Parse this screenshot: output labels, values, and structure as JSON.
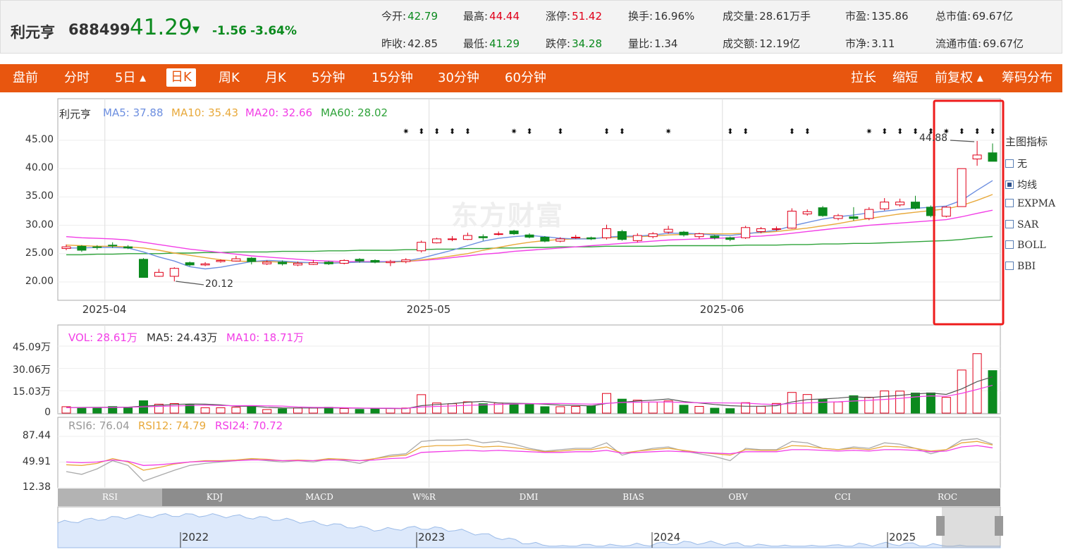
{
  "quote": {
    "name": "利元亨",
    "code": "688499",
    "price": "41.29",
    "arrow": "▼",
    "change": "-1.56",
    "change_pct": "-3.64%",
    "stats": [
      {
        "label": "今开:",
        "value": "42.79",
        "color": "green"
      },
      {
        "label": "最高:",
        "value": "44.44",
        "color": "red"
      },
      {
        "label": "涨停:",
        "value": "51.42",
        "color": "red"
      },
      {
        "label": "换手:",
        "value": "16.96%",
        "color": ""
      },
      {
        "label": "成交量:",
        "value": "28.61万手",
        "color": ""
      },
      {
        "label": "市盈:",
        "value": "135.86",
        "color": ""
      },
      {
        "label": "总市值:",
        "value": "69.67亿",
        "color": ""
      },
      {
        "label": "昨收:",
        "value": "42.85",
        "color": ""
      },
      {
        "label": "最低:",
        "value": "41.29",
        "color": "green"
      },
      {
        "label": "跌停:",
        "value": "34.28",
        "color": "green"
      },
      {
        "label": "量比:",
        "value": "1.34",
        "color": ""
      },
      {
        "label": "成交额:",
        "value": "12.19亿",
        "color": ""
      },
      {
        "label": "市净:",
        "value": "3.11",
        "color": ""
      },
      {
        "label": "流通市值:",
        "value": "69.67亿",
        "color": ""
      }
    ]
  },
  "toolbar": {
    "left": [
      "盘前",
      "分时",
      "5日 ▴",
      "日K",
      "周K",
      "月K",
      "5分钟",
      "15分钟",
      "30分钟",
      "60分钟"
    ],
    "active": "日K",
    "right": [
      "拉长",
      "缩短",
      "前复权 ▴",
      "筹码分布"
    ]
  },
  "main_legend": {
    "name": "利元亨",
    "ma5": "MA5: 37.88",
    "ma10": "MA10: 35.43",
    "ma20": "MA20: 32.66",
    "ma60": "MA60: 28.02"
  },
  "vol_legend": {
    "vol": "VOL: 28.61万",
    "ma5": "MA5: 24.43万",
    "ma10": "MA10: 18.71万"
  },
  "rsi_legend": {
    "rsi6": "RSI6: 76.04",
    "rsi12": "RSI12: 74.79",
    "rsi24": "RSI24: 70.72"
  },
  "annotations": {
    "high": "44.88",
    "low": "20.12"
  },
  "watermark": "东方财富",
  "side_panel": {
    "title": "主图指标",
    "options": [
      "无",
      "均线",
      "EXPMA",
      "SAR",
      "BOLL",
      "BBI"
    ],
    "checked": "均线"
  },
  "indicator_tabs": [
    "RSI",
    "KDJ",
    "MACD",
    "W%R",
    "DMI",
    "BIAS",
    "OBV",
    "CCI",
    "ROC"
  ],
  "indicator_active": "RSI",
  "overview_years": [
    "2022",
    "2023",
    "2024",
    "2025"
  ],
  "colors": {
    "up": "#e0001a",
    "down": "#0b8a1e",
    "ma5": "#6d8fe0",
    "ma10": "#e8a93b",
    "ma20": "#f23ee6",
    "ma60": "#2fa33a",
    "toolbar": "#e8560f",
    "highlight": "#ee1c1c"
  },
  "chart_data": {
    "type": "candlestick",
    "price_axis": {
      "ticks": [
        "45.00",
        "40.00",
        "35.00",
        "30.00",
        "25.00",
        "20.00"
      ],
      "range": [
        17,
        48
      ]
    },
    "x_labels": [
      {
        "index": 2,
        "label": "2025-04"
      },
      {
        "index": 23,
        "label": "2025-05"
      },
      {
        "index": 42,
        "label": "2025-06"
      }
    ],
    "candles": [
      {
        "o": 25.9,
        "c": 26.2,
        "h": 26.6,
        "l": 25.6
      },
      {
        "o": 26.3,
        "c": 25.6,
        "h": 26.5,
        "l": 25.3
      },
      {
        "o": 26.2,
        "c": 26.1,
        "h": 26.5,
        "l": 25.7
      },
      {
        "o": 26.5,
        "c": 26.4,
        "h": 27.0,
        "l": 26.0
      },
      {
        "o": 26.2,
        "c": 26.0,
        "h": 26.5,
        "l": 25.8
      },
      {
        "o": 24.0,
        "c": 20.8,
        "h": 24.2,
        "l": 20.8
      },
      {
        "o": 21.0,
        "c": 21.7,
        "h": 22.3,
        "l": 20.9
      },
      {
        "o": 21.0,
        "c": 22.4,
        "h": 22.6,
        "l": 20.1
      },
      {
        "o": 23.4,
        "c": 23.0,
        "h": 23.6,
        "l": 22.8
      },
      {
        "o": 23.0,
        "c": 23.2,
        "h": 23.5,
        "l": 22.8
      },
      {
        "o": 23.6,
        "c": 23.8,
        "h": 24.0,
        "l": 23.4
      },
      {
        "o": 23.7,
        "c": 24.1,
        "h": 24.6,
        "l": 23.6
      },
      {
        "o": 24.2,
        "c": 23.6,
        "h": 24.4,
        "l": 23.1
      },
      {
        "o": 23.2,
        "c": 23.5,
        "h": 23.8,
        "l": 23.0
      },
      {
        "o": 23.5,
        "c": 23.2,
        "h": 23.8,
        "l": 22.9
      },
      {
        "o": 23.0,
        "c": 23.3,
        "h": 23.6,
        "l": 22.8
      },
      {
        "o": 23.1,
        "c": 23.4,
        "h": 23.9,
        "l": 23.0
      },
      {
        "o": 23.5,
        "c": 23.2,
        "h": 23.7,
        "l": 23.0
      },
      {
        "o": 23.3,
        "c": 23.8,
        "h": 24.0,
        "l": 23.1
      },
      {
        "o": 24.0,
        "c": 23.7,
        "h": 24.2,
        "l": 23.4
      },
      {
        "o": 23.8,
        "c": 23.5,
        "h": 24.0,
        "l": 23.3
      },
      {
        "o": 23.4,
        "c": 23.6,
        "h": 23.9,
        "l": 22.8
      },
      {
        "o": 23.6,
        "c": 23.9,
        "h": 24.2,
        "l": 23.3
      },
      {
        "o": 25.5,
        "c": 27.0,
        "h": 27.3,
        "l": 25.2
      },
      {
        "o": 26.9,
        "c": 27.6,
        "h": 27.8,
        "l": 26.8
      },
      {
        "o": 27.6,
        "c": 27.6,
        "h": 28.1,
        "l": 27.2
      },
      {
        "o": 27.5,
        "c": 28.2,
        "h": 28.7,
        "l": 27.4
      },
      {
        "o": 28.0,
        "c": 27.8,
        "h": 28.4,
        "l": 27.3
      },
      {
        "o": 28.4,
        "c": 28.5,
        "h": 28.9,
        "l": 28.2
      },
      {
        "o": 29.0,
        "c": 28.5,
        "h": 29.2,
        "l": 28.3
      },
      {
        "o": 28.3,
        "c": 27.9,
        "h": 28.6,
        "l": 27.7
      },
      {
        "o": 27.9,
        "c": 27.2,
        "h": 28.1,
        "l": 27.0
      },
      {
        "o": 27.2,
        "c": 27.6,
        "h": 27.9,
        "l": 27.0
      },
      {
        "o": 27.8,
        "c": 27.9,
        "h": 28.3,
        "l": 27.6
      },
      {
        "o": 27.8,
        "c": 27.6,
        "h": 28.0,
        "l": 27.4
      },
      {
        "o": 27.8,
        "c": 29.4,
        "h": 30.1,
        "l": 27.5
      },
      {
        "o": 28.9,
        "c": 27.5,
        "h": 29.2,
        "l": 27.3
      },
      {
        "o": 27.3,
        "c": 28.2,
        "h": 28.6,
        "l": 27.0
      },
      {
        "o": 28.0,
        "c": 28.5,
        "h": 28.8,
        "l": 27.7
      },
      {
        "o": 28.8,
        "c": 29.3,
        "h": 29.9,
        "l": 28.5
      },
      {
        "o": 28.8,
        "c": 28.3,
        "h": 29.0,
        "l": 28.0
      },
      {
        "o": 28.0,
        "c": 28.5,
        "h": 28.7,
        "l": 27.6
      },
      {
        "o": 28.1,
        "c": 27.8,
        "h": 28.3,
        "l": 27.5
      },
      {
        "o": 27.8,
        "c": 27.5,
        "h": 28.0,
        "l": 27.2
      },
      {
        "o": 27.8,
        "c": 29.6,
        "h": 29.9,
        "l": 27.6
      },
      {
        "o": 28.9,
        "c": 29.4,
        "h": 29.7,
        "l": 28.6
      },
      {
        "o": 29.3,
        "c": 29.4,
        "h": 29.8,
        "l": 29.0
      },
      {
        "o": 29.5,
        "c": 32.5,
        "h": 33.0,
        "l": 29.4
      },
      {
        "o": 32.0,
        "c": 32.4,
        "h": 32.8,
        "l": 31.7
      },
      {
        "o": 33.1,
        "c": 31.7,
        "h": 33.4,
        "l": 31.5
      },
      {
        "o": 31.2,
        "c": 31.7,
        "h": 32.0,
        "l": 30.9
      },
      {
        "o": 31.5,
        "c": 31.2,
        "h": 33.2,
        "l": 30.8
      },
      {
        "o": 31.2,
        "c": 32.8,
        "h": 33.2,
        "l": 30.9
      },
      {
        "o": 32.9,
        "c": 34.1,
        "h": 34.8,
        "l": 32.6
      },
      {
        "o": 33.6,
        "c": 34.1,
        "h": 34.7,
        "l": 33.3
      },
      {
        "o": 34.1,
        "c": 33.0,
        "h": 35.2,
        "l": 32.8
      },
      {
        "o": 33.2,
        "c": 31.7,
        "h": 33.5,
        "l": 31.4
      },
      {
        "o": 31.6,
        "c": 33.2,
        "h": 33.4,
        "l": 31.4
      },
      {
        "o": 33.3,
        "c": 40.0,
        "h": 40.0,
        "l": 33.3
      },
      {
        "o": 41.7,
        "c": 42.4,
        "h": 44.88,
        "l": 40.5
      },
      {
        "o": 42.79,
        "c": 41.29,
        "h": 44.44,
        "l": 41.29
      }
    ],
    "ma5": [
      26.0,
      26.0,
      26.1,
      26.1,
      26.0,
      25.3,
      24.4,
      23.7,
      22.7,
      22.3,
      22.6,
      23.1,
      23.6,
      23.8,
      23.7,
      23.5,
      23.4,
      23.3,
      23.4,
      23.5,
      23.5,
      23.6,
      23.7,
      24.2,
      24.9,
      25.6,
      26.4,
      27.2,
      27.7,
      28.0,
      28.2,
      28.0,
      27.7,
      27.6,
      27.6,
      27.9,
      28.1,
      28.1,
      28.3,
      28.6,
      28.6,
      28.5,
      28.3,
      28.2,
      28.5,
      28.8,
      29.1,
      29.9,
      30.5,
      31.1,
      31.5,
      31.8,
      32.2,
      32.5,
      32.8,
      33.0,
      33.2,
      33.4,
      34.4,
      36.2,
      37.88
    ],
    "ma10": [
      26.5,
      26.4,
      26.3,
      26.3,
      26.2,
      26.0,
      25.6,
      25.1,
      24.7,
      24.3,
      23.9,
      23.7,
      23.6,
      23.6,
      23.5,
      23.4,
      23.4,
      23.4,
      23.4,
      23.5,
      23.5,
      23.5,
      23.6,
      23.9,
      24.2,
      24.6,
      25.0,
      25.6,
      26.1,
      26.6,
      27.0,
      27.3,
      27.5,
      27.6,
      27.7,
      27.8,
      27.9,
      28.0,
      28.1,
      28.3,
      28.4,
      28.5,
      28.5,
      28.5,
      28.6,
      28.7,
      28.9,
      29.2,
      29.5,
      29.9,
      30.3,
      30.8,
      31.2,
      31.6,
      32.0,
      32.3,
      32.6,
      32.9,
      33.5,
      34.4,
      35.43
    ],
    "ma20": [
      28.0,
      27.8,
      27.7,
      27.6,
      27.4,
      27.0,
      26.6,
      26.2,
      25.8,
      25.5,
      25.2,
      24.9,
      24.6,
      24.4,
      24.2,
      24.0,
      23.8,
      23.7,
      23.6,
      23.6,
      23.6,
      23.6,
      23.6,
      23.8,
      24.0,
      24.3,
      24.6,
      24.9,
      25.1,
      25.4,
      25.6,
      25.8,
      26.0,
      26.2,
      26.4,
      26.6,
      26.8,
      27.0,
      27.2,
      27.4,
      27.5,
      27.6,
      27.7,
      27.8,
      28.0,
      28.1,
      28.3,
      28.6,
      28.9,
      29.2,
      29.5,
      29.7,
      30.0,
      30.2,
      30.4,
      30.6,
      30.8,
      31.0,
      31.5,
      32.1,
      32.66
    ],
    "ma60": [
      24.8,
      24.8,
      24.9,
      24.9,
      25.0,
      25.0,
      25.0,
      25.1,
      25.1,
      25.2,
      25.2,
      25.3,
      25.3,
      25.3,
      25.4,
      25.4,
      25.4,
      25.5,
      25.5,
      25.6,
      25.6,
      25.6,
      25.7,
      25.7,
      25.8,
      25.8,
      25.9,
      25.9,
      26.0,
      26.0,
      26.1,
      26.1,
      26.2,
      26.2,
      26.2,
      26.3,
      26.3,
      26.3,
      26.3,
      26.4,
      26.4,
      26.4,
      26.4,
      26.4,
      26.5,
      26.5,
      26.5,
      26.6,
      26.6,
      26.7,
      26.7,
      26.8,
      26.8,
      26.9,
      27.0,
      27.1,
      27.2,
      27.3,
      27.5,
      27.8,
      28.02
    ],
    "volume": {
      "unit": "万",
      "ticks": [
        "45.09万",
        "30.06万",
        "15.03万",
        "0"
      ],
      "max": 45.09,
      "values": [
        4.3,
        3.7,
        3.3,
        4.4,
        4.0,
        8.3,
        6.0,
        6.4,
        5.6,
        3.6,
        3.6,
        3.9,
        4.2,
        2.4,
        2.9,
        3.5,
        3.4,
        3.9,
        3.1,
        2.5,
        3.0,
        3.2,
        3.4,
        12.4,
        6.8,
        6.3,
        7.6,
        6.3,
        6.8,
        5.8,
        5.8,
        4.3,
        4.3,
        4.5,
        4.9,
        13.2,
        9.4,
        8.7,
        7.4,
        8.2,
        5.3,
        4.5,
        3.3,
        3.0,
        7.0,
        4.5,
        6.5,
        13.9,
        12.5,
        9.2,
        7.5,
        11.7,
        10.7,
        14.9,
        14.8,
        13.5,
        13.6,
        10.6,
        29.0,
        40.0,
        28.61
      ],
      "ma5": [
        3.7,
        3.8,
        3.9,
        4.0,
        4.0,
        4.7,
        5.2,
        5.8,
        6.1,
        6.0,
        5.5,
        4.6,
        4.7,
        3.9,
        3.5,
        3.4,
        3.4,
        3.5,
        3.4,
        3.3,
        3.2,
        3.1,
        3.0,
        5.0,
        5.8,
        6.4,
        7.3,
        7.9,
        6.8,
        6.6,
        6.4,
        6.0,
        5.4,
        5.2,
        4.8,
        6.5,
        7.3,
        8.1,
        8.7,
        9.5,
        7.8,
        6.8,
        5.8,
        5.0,
        4.6,
        4.6,
        5.0,
        7.5,
        9.1,
        9.5,
        10.1,
        11.0,
        10.4,
        11.2,
        11.9,
        12.9,
        13.5,
        12.6,
        16.3,
        21.2,
        24.43
      ],
      "ma10": [
        3.6,
        3.7,
        3.7,
        3.8,
        3.9,
        4.2,
        4.5,
        4.8,
        5.1,
        5.3,
        5.1,
        5.0,
        5.1,
        4.9,
        4.7,
        4.2,
        3.9,
        3.8,
        3.6,
        3.4,
        3.3,
        3.3,
        3.2,
        4.1,
        4.5,
        4.8,
        5.2,
        5.5,
        5.9,
        6.1,
        6.3,
        6.4,
        6.5,
        6.3,
        6.0,
        6.6,
        7.1,
        7.3,
        7.4,
        7.5,
        7.1,
        7.0,
        6.9,
        6.8,
        6.7,
        6.1,
        5.8,
        6.4,
        6.9,
        7.3,
        7.6,
        8.1,
        8.6,
        9.2,
        9.9,
        10.9,
        11.6,
        11.3,
        13.3,
        15.9,
        18.71
      ]
    },
    "rsi": {
      "ticks": [
        "87.44",
        "49.91",
        "12.38"
      ],
      "range": [
        12.38,
        87.44
      ],
      "rsi6": [
        36,
        32,
        40,
        52,
        45,
        22,
        30,
        38,
        45,
        48,
        50,
        52,
        54,
        52,
        50,
        52,
        50,
        54,
        52,
        48,
        55,
        60,
        62,
        80,
        82,
        82,
        83,
        78,
        80,
        76,
        70,
        66,
        68,
        70,
        70,
        78,
        60,
        66,
        70,
        72,
        66,
        62,
        58,
        52,
        70,
        68,
        68,
        80,
        78,
        70,
        68,
        72,
        70,
        78,
        76,
        70,
        62,
        68,
        82,
        84,
        76.04
      ],
      "rsi12": [
        46,
        45,
        48,
        55,
        50,
        38,
        42,
        47,
        50,
        52,
        52,
        53,
        55,
        54,
        52,
        53,
        52,
        55,
        54,
        52,
        55,
        58,
        60,
        72,
        74,
        74,
        75,
        72,
        73,
        71,
        68,
        65,
        66,
        68,
        68,
        72,
        63,
        66,
        68,
        70,
        67,
        64,
        62,
        60,
        68,
        67,
        67,
        74,
        73,
        70,
        68,
        70,
        68,
        73,
        72,
        70,
        66,
        68,
        78,
        80,
        74.79
      ],
      "rsi24": [
        50,
        49,
        50,
        53,
        51,
        45,
        46,
        48,
        50,
        51,
        51,
        52,
        53,
        53,
        52,
        52,
        52,
        53,
        53,
        52,
        53,
        55,
        56,
        64,
        65,
        66,
        67,
        66,
        67,
        66,
        65,
        64,
        64,
        65,
        65,
        67,
        63,
        64,
        65,
        66,
        65,
        64,
        63,
        62,
        65,
        65,
        65,
        68,
        68,
        67,
        66,
        67,
        66,
        68,
        68,
        67,
        65,
        66,
        72,
        74,
        70.72
      ]
    }
  }
}
